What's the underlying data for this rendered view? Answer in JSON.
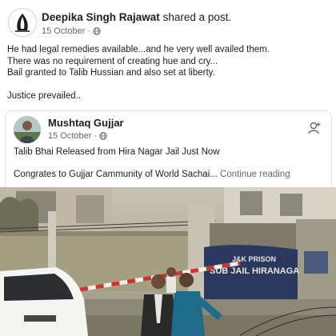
{
  "post": {
    "author": "Deepika Singh Rajawat",
    "action": "shared a post.",
    "date": "15 October",
    "separator": "·",
    "text_lines": [
      "He had legal remedies available...and he very well availed them.",
      "There was no requirement of creating hue and cry...",
      "Bail granted to Talib Hussian and also set at liberty."
    ],
    "closing_line": "Justice prevailed.."
  },
  "shared": {
    "author": "Mushtaq Gujjar",
    "date": "15 October",
    "separator": "·",
    "line1": "Talib Bhai Released from Hira Nagar Jail Just Now",
    "line2": "Congrates to Gujjar Cammunity of World  Sachai...",
    "continue": "Continue reading"
  },
  "photo": {
    "sign_line1": "J&K PRISON",
    "sign_line2": "SUB JAIL HIRANAGA"
  },
  "colors": {
    "text_primary": "#1c1e21",
    "text_secondary": "#65676b",
    "card_border": "#dddfe2"
  },
  "icons": [
    "globe-icon",
    "more-options-icon",
    "follow-icon"
  ]
}
